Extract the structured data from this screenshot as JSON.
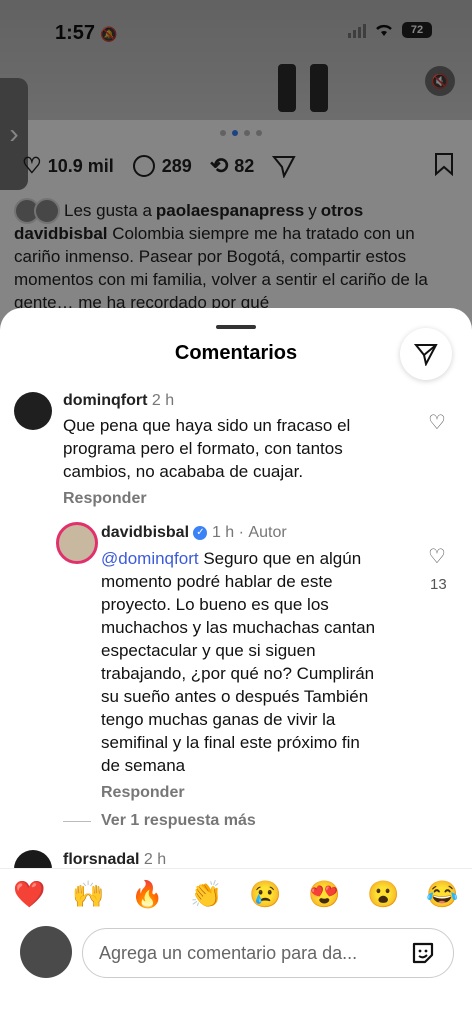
{
  "status": {
    "time": "1:57",
    "battery": "72"
  },
  "post": {
    "likes": "10.9 mil",
    "comments": "289",
    "reposts": "82",
    "liked_by_prefix": "Les gusta a",
    "liked_by_user": "paolaespanapress",
    "liked_by_join": "y",
    "liked_by_others": "otros",
    "caption_user": "davidbisbal",
    "caption_text": "Colombia siempre me ha tratado con un cariño inmenso. Pasear por Bogotá, compartir estos momentos con mi familia, volver a sentir el cariño de la gente… me ha recordado por qué"
  },
  "sheet": {
    "title": "Comentarios",
    "comments": [
      {
        "user": "dominqfort",
        "time": "2 h",
        "text": "Que pena que haya sido un fracaso el programa pero el formato, con tantos cambios, no acababa de cuajar.",
        "reply_label": "Responder"
      },
      {
        "user": "davidbisbal",
        "time": "1 h",
        "author_tag": "Autor",
        "mention": "@dominqfort",
        "text": "Seguro que en algún momento podré hablar de este proyecto. Lo bueno es que los muchachos y las muchachas cantan espectacular y que si siguen trabajando, ¿por qué no? Cumplirán su sueño antes o después También tengo muchas ganas de vivir la semifinal y la final este próximo fin de semana",
        "reply_label": "Responder",
        "likes": "13"
      },
      {
        "user": "florsnadal",
        "time": "2 h"
      }
    ],
    "more_replies": "Ver 1 respuesta más"
  },
  "emojis": [
    "❤️",
    "🙌",
    "🔥",
    "👏",
    "😢",
    "😍",
    "😮",
    "😂"
  ],
  "composer": {
    "placeholder": "Agrega un comentario para da..."
  }
}
